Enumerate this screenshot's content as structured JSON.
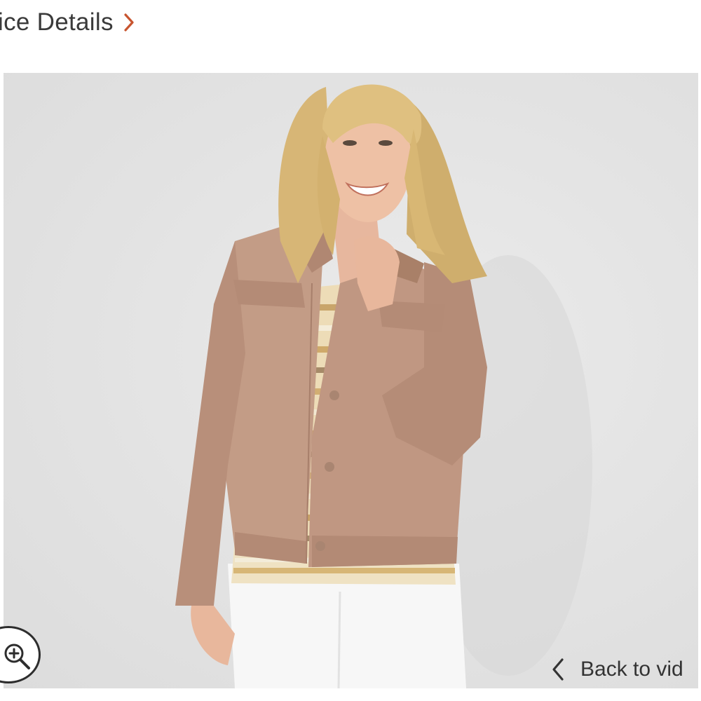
{
  "header": {
    "link_label": "ice Details",
    "link_icon": "chevron-right-icon",
    "accent_color": "#c8552f"
  },
  "media": {
    "image_alt": "",
    "zoom_icon": "zoom-in-icon",
    "back_label": "Back to vid",
    "back_icon": "chevron-left-icon"
  }
}
